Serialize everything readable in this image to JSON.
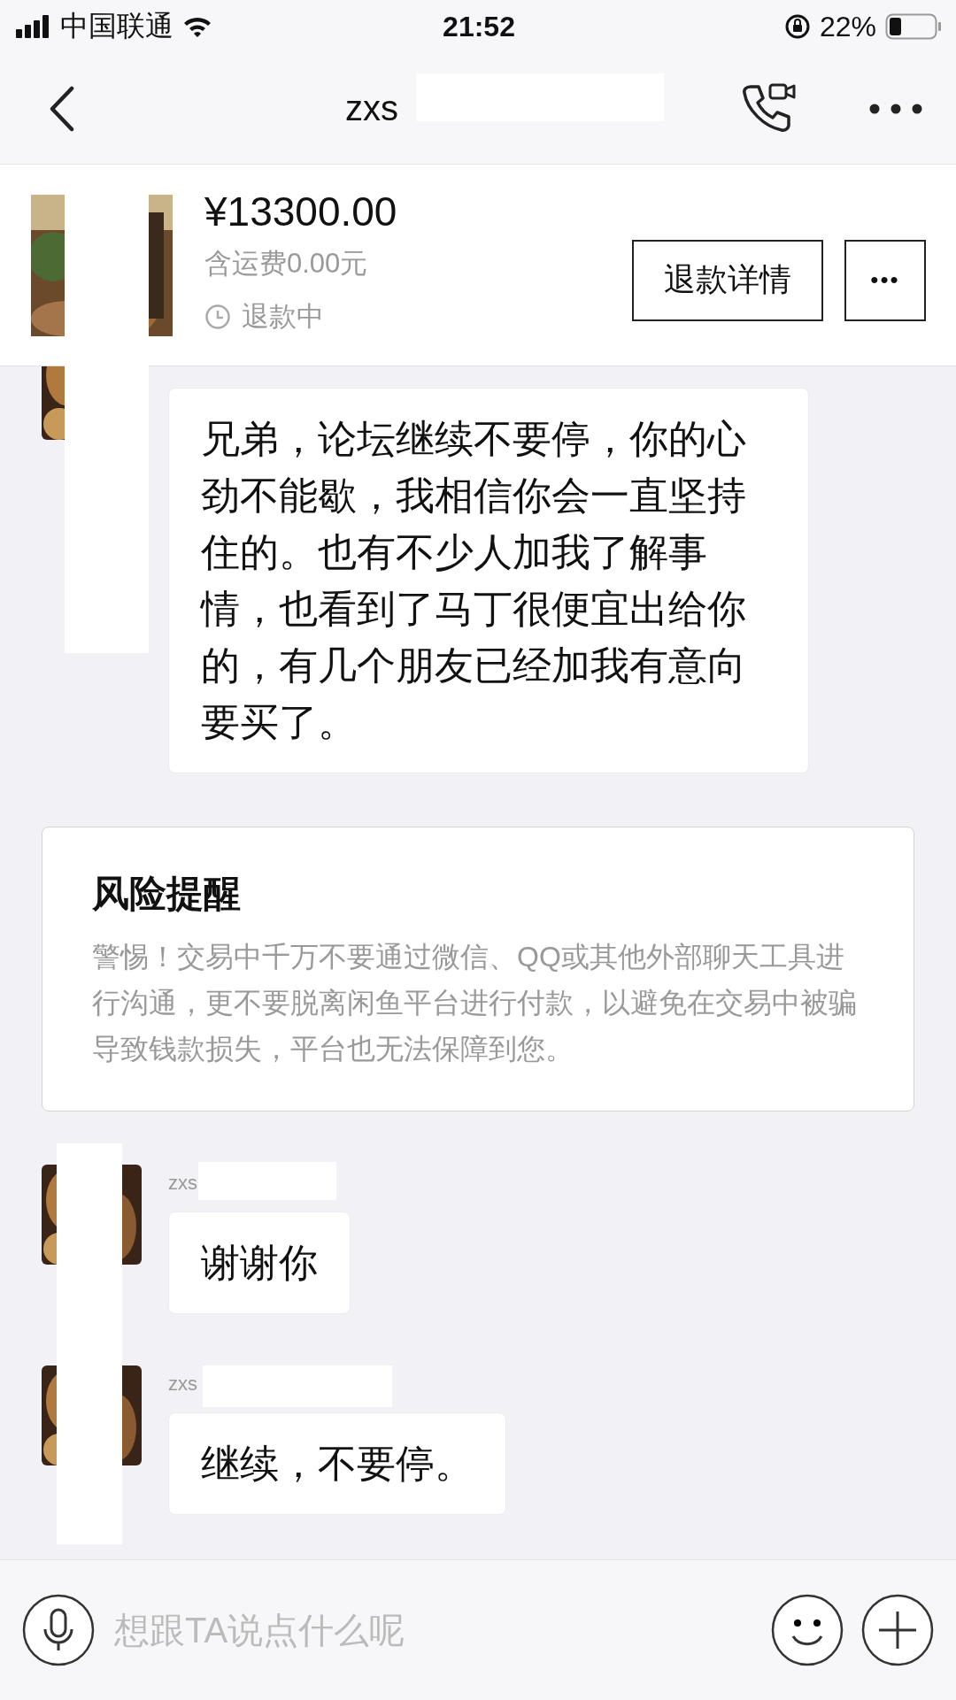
{
  "status_bar": {
    "carrier": "中国联通",
    "time": "21:52",
    "battery": "22%"
  },
  "nav": {
    "title": "zxs"
  },
  "product": {
    "price": "¥13300.00",
    "shipping": "含运费0.00元",
    "status": "退款中",
    "buttons": [
      {
        "kind": "text",
        "label": "退款详情"
      },
      {
        "kind": "more",
        "label": "•••"
      }
    ]
  },
  "chat": [
    {
      "kind": "message",
      "text": "兄弟，论坛继续不要停，你的心劲不能歇，我相信你会一直坚持住的。也有不少人加我了解事情，也看到了马丁很便宜出给你的，有几个朋友已经加我有意向要买了。"
    },
    {
      "kind": "notice",
      "title": "风险提醒",
      "text": "警惕！交易中千万不要通过微信、QQ或其他外部聊天工具进行沟通，更不要脱离闲鱼平台进行付款，以避免在交易中被骗导致钱款损失，平台也无法保障到您。"
    },
    {
      "kind": "message",
      "sender": "zxs",
      "text": "谢谢你"
    },
    {
      "kind": "message",
      "sender": "zxs",
      "text": "继续，不要停。"
    }
  ],
  "input": {
    "placeholder": "想跟TA说点什么呢"
  }
}
